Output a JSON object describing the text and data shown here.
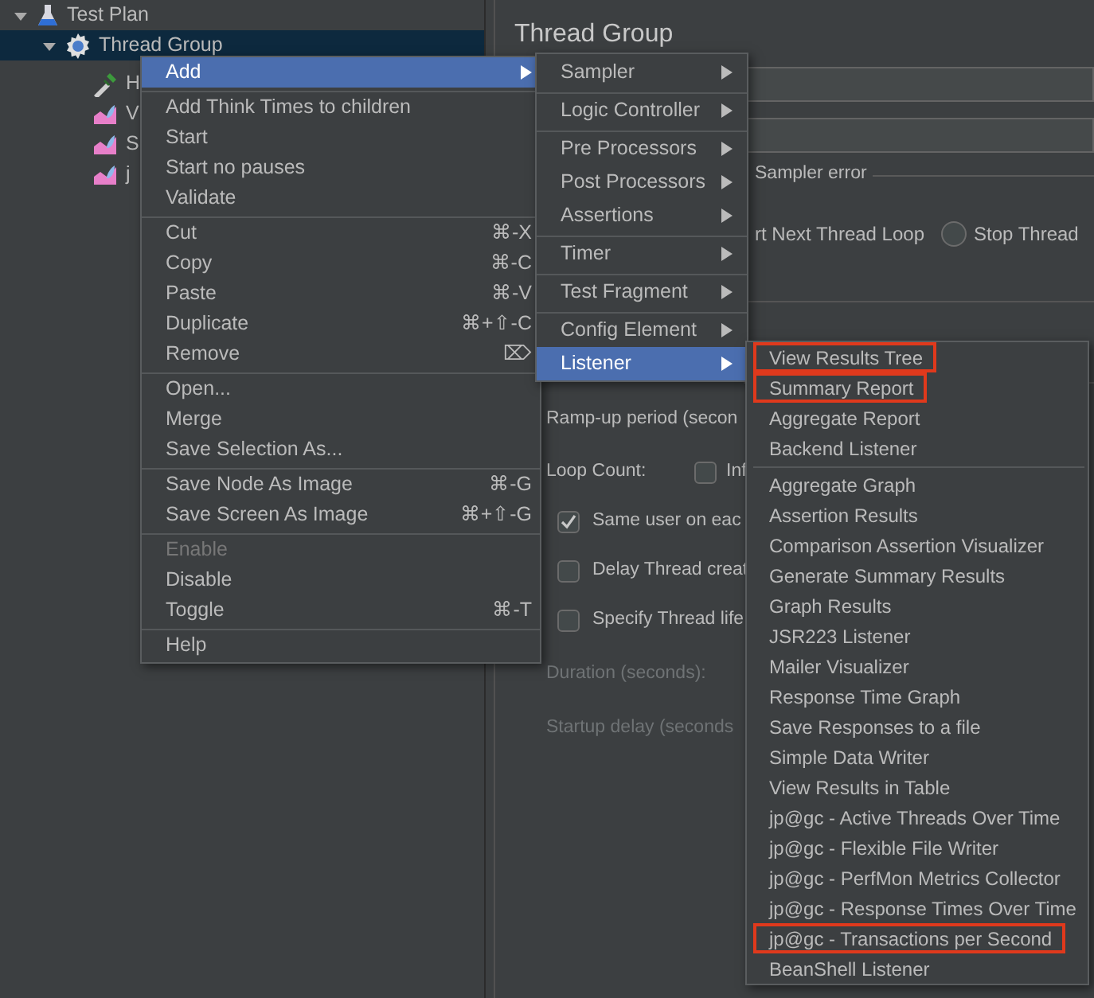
{
  "tree": [
    {
      "label": "Test Plan",
      "kind": "plan",
      "expanded": true,
      "selected": false,
      "children": [
        {
          "label": "Thread Group",
          "kind": "threads",
          "expanded": true,
          "selected": true,
          "children": [
            {
              "label": "H",
              "kind": "config",
              "selected": false
            },
            {
              "label": "V",
              "kind": "listener",
              "selected": false
            },
            {
              "label": "S",
              "kind": "listener",
              "selected": false
            },
            {
              "label": "j",
              "kind": "listener",
              "selected": false
            }
          ]
        }
      ]
    }
  ],
  "panel": {
    "title": "Thread Group",
    "group_label": "Sampler error",
    "actions": [
      {
        "label": "rt Next Thread Loop",
        "kind": "text"
      },
      {
        "label": "Stop Thread",
        "kind": "radio",
        "selected": false
      }
    ],
    "ramp_up_label": "Ramp-up period (secon",
    "loop_count": {
      "label": "Loop Count:",
      "infinite": {
        "label": "Inf",
        "checked": false
      }
    },
    "options": [
      {
        "label": "Same user on eac",
        "checked": true
      },
      {
        "label": "Delay Thread creat",
        "checked": false
      },
      {
        "label": "Specify Thread life",
        "checked": false
      }
    ],
    "duration_label": "Duration (seconds):",
    "startup_delay_label": "Startup delay (seconds"
  },
  "context_menu": {
    "groups": [
      [
        {
          "label": "Add",
          "submenu": true,
          "selected": true,
          "disabled": false
        }
      ],
      [
        {
          "label": "Add Think Times to children",
          "submenu": false,
          "selected": false,
          "disabled": false
        },
        {
          "label": "Start",
          "submenu": false,
          "selected": false,
          "disabled": false
        },
        {
          "label": "Start no pauses",
          "submenu": false,
          "selected": false,
          "disabled": false
        },
        {
          "label": "Validate",
          "submenu": false,
          "selected": false,
          "disabled": false
        }
      ],
      [
        {
          "label": "Cut",
          "shortcut": "⌘-X",
          "submenu": false,
          "selected": false,
          "disabled": false
        },
        {
          "label": "Copy",
          "shortcut": "⌘-C",
          "submenu": false,
          "selected": false,
          "disabled": false
        },
        {
          "label": "Paste",
          "shortcut": "⌘-V",
          "submenu": false,
          "selected": false,
          "disabled": false
        },
        {
          "label": "Duplicate",
          "shortcut": "⌘+⇧-C",
          "submenu": false,
          "selected": false,
          "disabled": false
        },
        {
          "label": "Remove",
          "shortcut": "⌦",
          "submenu": false,
          "selected": false,
          "disabled": false
        }
      ],
      [
        {
          "label": "Open...",
          "submenu": false,
          "selected": false,
          "disabled": false
        },
        {
          "label": "Merge",
          "submenu": false,
          "selected": false,
          "disabled": false
        },
        {
          "label": "Save Selection As...",
          "submenu": false,
          "selected": false,
          "disabled": false
        }
      ],
      [
        {
          "label": "Save Node As Image",
          "shortcut": "⌘-G",
          "submenu": false,
          "selected": false,
          "disabled": false
        },
        {
          "label": "Save Screen As Image",
          "shortcut": "⌘+⇧-G",
          "submenu": false,
          "selected": false,
          "disabled": false
        }
      ],
      [
        {
          "label": "Enable",
          "submenu": false,
          "selected": false,
          "disabled": true
        },
        {
          "label": "Disable",
          "submenu": false,
          "selected": false,
          "disabled": false
        },
        {
          "label": "Toggle",
          "shortcut": "⌘-T",
          "submenu": false,
          "selected": false,
          "disabled": false
        }
      ],
      [
        {
          "label": "Help",
          "submenu": false,
          "selected": false,
          "disabled": false
        }
      ]
    ]
  },
  "add_submenu": {
    "groups": [
      [
        {
          "label": "Sampler",
          "submenu": true,
          "selected": false
        }
      ],
      [
        {
          "label": "Logic Controller",
          "submenu": true,
          "selected": false
        }
      ],
      [
        {
          "label": "Pre Processors",
          "submenu": true,
          "selected": false
        },
        {
          "label": "Post Processors",
          "submenu": true,
          "selected": false
        },
        {
          "label": "Assertions",
          "submenu": true,
          "selected": false
        }
      ],
      [
        {
          "label": "Timer",
          "submenu": true,
          "selected": false
        }
      ],
      [
        {
          "label": "Test Fragment",
          "submenu": true,
          "selected": false
        }
      ],
      [
        {
          "label": "Config Element",
          "submenu": true,
          "selected": false
        },
        {
          "label": "Listener",
          "submenu": true,
          "selected": true
        }
      ]
    ]
  },
  "listener_submenu": {
    "groups": [
      [
        {
          "label": "View Results Tree",
          "outlined": true
        },
        {
          "label": "Summary Report",
          "outlined": true
        },
        {
          "label": "Aggregate Report",
          "outlined": false
        },
        {
          "label": "Backend Listener",
          "outlined": false
        }
      ],
      [
        {
          "label": "Aggregate Graph",
          "outlined": false
        },
        {
          "label": "Assertion Results",
          "outlined": false
        },
        {
          "label": "Comparison Assertion Visualizer",
          "outlined": false
        },
        {
          "label": "Generate Summary Results",
          "outlined": false
        },
        {
          "label": "Graph Results",
          "outlined": false
        },
        {
          "label": "JSR223 Listener",
          "outlined": false
        },
        {
          "label": "Mailer Visualizer",
          "outlined": false
        },
        {
          "label": "Response Time Graph",
          "outlined": false
        },
        {
          "label": "Save Responses to a file",
          "outlined": false
        },
        {
          "label": "Simple Data Writer",
          "outlined": false
        },
        {
          "label": "View Results in Table",
          "outlined": false
        },
        {
          "label": "jp@gc - Active Threads Over Time",
          "outlined": false
        },
        {
          "label": "jp@gc - Flexible File Writer",
          "outlined": false
        },
        {
          "label": "jp@gc - PerfMon Metrics Collector",
          "outlined": false
        },
        {
          "label": "jp@gc - Response Times Over Time",
          "outlined": false
        },
        {
          "label": "jp@gc - Transactions per Second",
          "outlined": true
        },
        {
          "label": "BeanShell Listener",
          "outlined": false
        }
      ]
    ]
  }
}
